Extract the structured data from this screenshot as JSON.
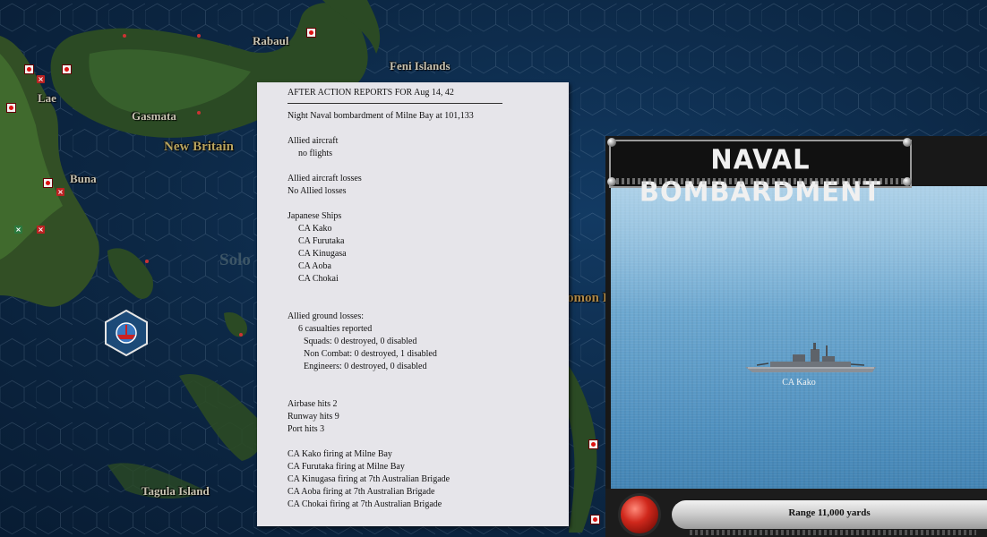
{
  "map": {
    "labels": {
      "rabaul": "Rabaul",
      "feni": "Feni Islands",
      "lae": "Lae",
      "gasmata": "Gasmata",
      "new_britain": "New Britain",
      "buna": "Buna",
      "solomon_sea": "Solo",
      "solomon_islands": "omon I",
      "tagula": "Tagula Island"
    }
  },
  "report": {
    "lines": {
      "header": "AFTER ACTION REPORTS FOR Aug 14, 42",
      "event": "Night Naval bombardment of Milne Bay at 101,133",
      "allied_aircraft": "Allied aircraft",
      "no_flights": "no flights",
      "allied_aircraft_losses": "Allied aircraft losses",
      "no_allied_losses": "No Allied losses",
      "japanese_ships": "Japanese Ships",
      "ship1": "CA Kako",
      "ship2": "CA Furutaka",
      "ship3": "CA Kinugasa",
      "ship4": "CA Aoba",
      "ship5": "CA Chokai",
      "ground_losses": "Allied ground losses:",
      "casualties": "6 casualties reported",
      "squads": "Squads: 0 destroyed, 0 disabled",
      "non_combat": "Non Combat: 0 destroyed, 1 disabled",
      "engineers": "Engineers: 0 destroyed, 0 disabled",
      "airbase_hits": "Airbase hits 2",
      "runway_hits": "Runway hits 9",
      "port_hits": "Port hits 3",
      "fire1": "CA Kako firing at Milne Bay",
      "fire2": "CA Furutaka firing at Milne Bay",
      "fire3": "CA Kinugasa firing at 7th Australian Brigade",
      "fire4": "CA Aoba firing at 7th Australian Brigade",
      "fire5": "CA Chokai firing at 7th Australian Brigade"
    }
  },
  "bombardment": {
    "title": "NAVAL BOMBARDMENT",
    "ship_label": "CA Kako",
    "range": "Range 11,000 yards"
  }
}
